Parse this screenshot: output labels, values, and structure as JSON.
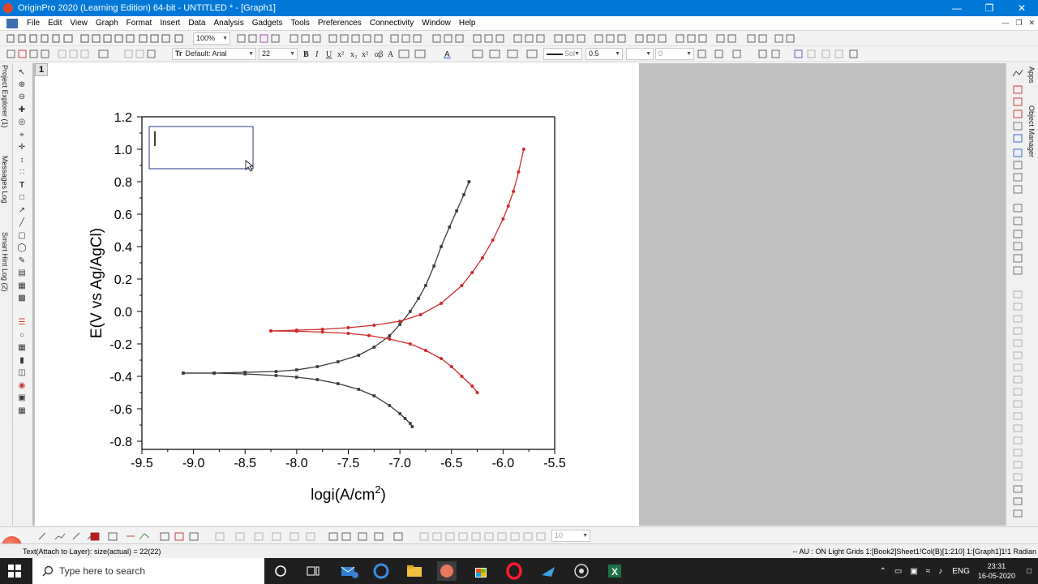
{
  "window": {
    "title": "OriginPro 2020 (Learning Edition) 64-bit - UNTITLED * - [Graph1]"
  },
  "menu": [
    "File",
    "Edit",
    "View",
    "Graph",
    "Format",
    "Insert",
    "Data",
    "Analysis",
    "Gadgets",
    "Tools",
    "Preferences",
    "Connectivity",
    "Window",
    "Help"
  ],
  "toolbar1": {
    "zoom": "100%"
  },
  "toolbar2": {
    "font": "Default: Arial",
    "font_size": "22",
    "line_style": "Sol",
    "line_width": "0.5",
    "value_field": "0"
  },
  "bottom_toolbar": {
    "value_field": "10"
  },
  "left_tabs": [
    "Project Explorer (1)",
    "Messages Log",
    "Smart Hint Log (2)"
  ],
  "right_tabs": [
    "Apps",
    "Object Manager"
  ],
  "graph": {
    "layer_label": "1"
  },
  "chart_data": {
    "type": "scatter",
    "xlabel": "logi(A/cm",
    "xlabel_sup": "2",
    "xlabel_close": ")",
    "ylabel": "E(V vs Ag/AgCl)",
    "xlim": [
      -9.5,
      -5.5
    ],
    "ylim": [
      -0.85,
      1.2
    ],
    "x_ticks": [
      "-9.5",
      "-9.0",
      "-8.5",
      "-8.0",
      "-7.5",
      "-7.0",
      "-6.5",
      "-6.0",
      "-5.5"
    ],
    "y_ticks": [
      "1.2",
      "1.0",
      "0.8",
      "0.6",
      "0.4",
      "0.2",
      "0.0",
      "-0.2",
      "-0.4",
      "-0.6",
      "-0.8"
    ],
    "grid": false,
    "series": [
      {
        "color": "#3a3a3a",
        "marker": "square",
        "x": [
          -9.1,
          -8.8,
          -8.5,
          -8.2,
          -8.0,
          -7.8,
          -7.6,
          -7.4,
          -7.25,
          -7.1,
          -7.0,
          -6.9,
          -6.82,
          -6.75,
          -6.67,
          -6.6,
          -6.52,
          -6.45,
          -6.38,
          -6.33
        ],
        "y": [
          -0.38,
          -0.38,
          -0.375,
          -0.37,
          -0.36,
          -0.34,
          -0.31,
          -0.27,
          -0.22,
          -0.15,
          -0.08,
          0.0,
          0.08,
          0.16,
          0.28,
          0.4,
          0.52,
          0.62,
          0.72,
          0.8
        ]
      },
      {
        "color": "#3a3a3a",
        "marker": "square",
        "x": [
          -9.1,
          -8.8,
          -8.5,
          -8.2,
          -8.0,
          -7.8,
          -7.6,
          -7.4,
          -7.25,
          -7.1,
          -7.0,
          -6.95,
          -6.9,
          -6.88
        ],
        "y": [
          -0.38,
          -0.38,
          -0.385,
          -0.395,
          -0.405,
          -0.42,
          -0.445,
          -0.48,
          -0.52,
          -0.58,
          -0.63,
          -0.66,
          -0.69,
          -0.71
        ]
      },
      {
        "color": "#d02a2a",
        "marker": "circle",
        "x": [
          -8.25,
          -8.0,
          -7.75,
          -7.5,
          -7.25,
          -7.0,
          -6.8,
          -6.6,
          -6.4,
          -6.3,
          -6.2,
          -6.1,
          -6.0,
          -5.95,
          -5.9,
          -5.85,
          -5.8
        ],
        "y": [
          -0.12,
          -0.115,
          -0.11,
          -0.1,
          -0.085,
          -0.06,
          -0.02,
          0.05,
          0.16,
          0.24,
          0.33,
          0.44,
          0.57,
          0.65,
          0.74,
          0.86,
          1.0
        ]
      },
      {
        "color": "#d02a2a",
        "marker": "circle",
        "x": [
          -8.25,
          -8.0,
          -7.75,
          -7.5,
          -7.3,
          -7.1,
          -6.9,
          -6.75,
          -6.6,
          -6.5,
          -6.4,
          -6.3,
          -6.25
        ],
        "y": [
          -0.12,
          -0.122,
          -0.127,
          -0.135,
          -0.148,
          -0.17,
          -0.2,
          -0.24,
          -0.29,
          -0.34,
          -0.4,
          -0.46,
          -0.5
        ]
      }
    ]
  },
  "status": {
    "left": "Text(Attach to Layer): size(actual) = 22(22)",
    "right": "-- AU : ON  Light Grids  1:[Book2]Sheet1!Col(B)[1:210]  1:[Graph1]1!1  Radian"
  },
  "taskbar": {
    "search_placeholder": "Type here to search",
    "lang": "ENG",
    "time": "23:31",
    "date": "16-05-2020"
  }
}
